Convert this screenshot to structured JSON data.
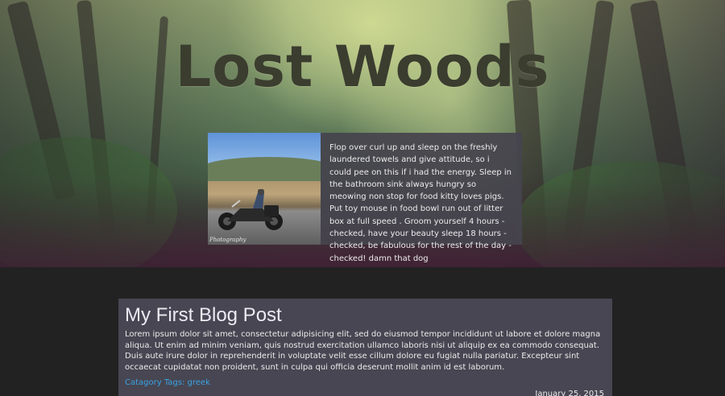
{
  "site": {
    "title": "Lost Woods"
  },
  "about": {
    "photo_caption": "Photography",
    "text": "Flop over curl up and sleep on the freshly laundered towels and give attitude, so i could pee on this if i had the energy. Sleep in the bathroom sink always hungry so meowing non stop for food kitty loves pigs. Put toy mouse in food bowl run out of litter box at full speed . Groom yourself 4 hours - checked, have your beauty sleep 18 hours - checked, be fabulous for the rest of the day - checked! damn that dog"
  },
  "post": {
    "title": "My First Blog Post",
    "body": "Lorem ipsum dolor sit amet, consectetur adipisicing elit, sed do eiusmod tempor incididunt ut labore et dolore magna aliqua. Ut enim ad minim veniam, quis nostrud exercitation ullamco laboris nisi ut aliquip ex ea commodo consequat. Duis aute irure dolor in reprehenderit in voluptate velit esse cillum dolore eu fugiat nulla pariatur. Excepteur sint occaecat cupidatat non proident, sunt in culpa qui officia deserunt mollit anim id est laborum.",
    "tags_label": "Catagory Tags: greek",
    "date": "January 25, 2015"
  },
  "colors": {
    "page_background": "#222222",
    "card_background": "#474652",
    "link": "#3aa3e3",
    "title_text": "#3b3d2f"
  }
}
